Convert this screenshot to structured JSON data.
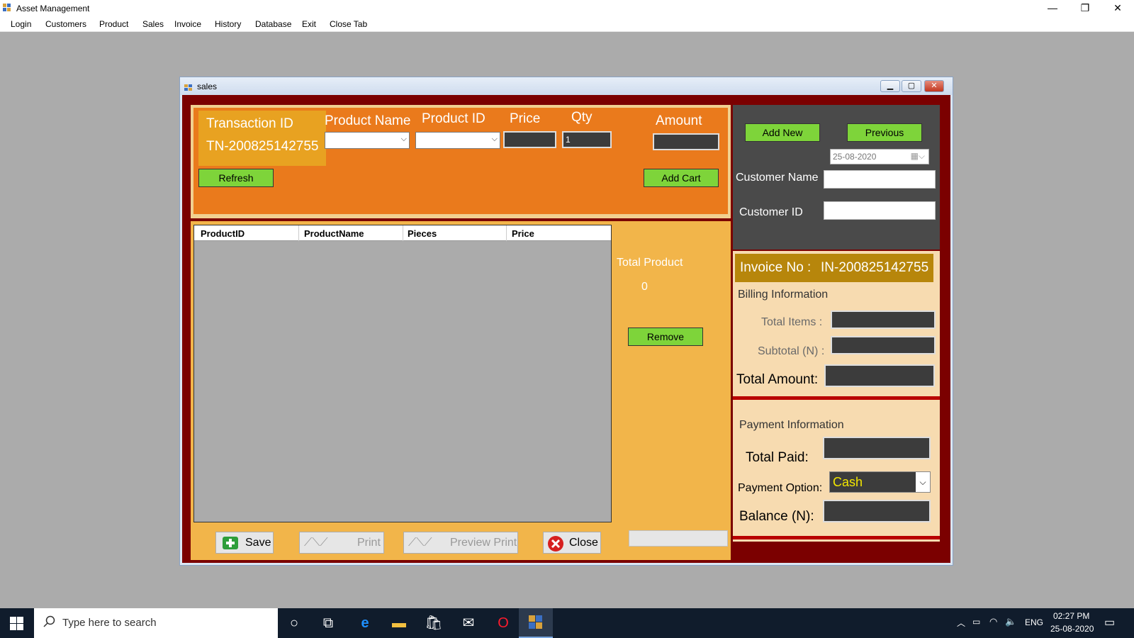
{
  "app": {
    "title": "Asset Management",
    "controls": {
      "minimize": "—",
      "maximize": "❐",
      "close": "✕"
    }
  },
  "menu": [
    "Login",
    "Customers",
    "Product",
    "Sales",
    "Invoice",
    "History",
    "Database",
    "Exit",
    "Close Tab"
  ],
  "sales_window": {
    "title": "sales",
    "transaction": {
      "label": "Transaction ID",
      "value": "TN-200825142755"
    },
    "product_name_label": "Product Name",
    "product_id_label": "Product ID",
    "price_label": "Price",
    "qty_label": "Qty",
    "qty_value": "1",
    "amount_label": "Amount",
    "refresh_label": "Refresh",
    "add_cart_label": "Add Cart",
    "grid_columns": [
      "ProductID",
      "ProductName",
      "Pieces",
      "Price"
    ],
    "total_product_label": "Total Product",
    "total_product_value": "0",
    "remove_label": "Remove",
    "save_label": "Save",
    "print_label": "Print",
    "preview_print_label": "Preview Print",
    "close_label": "Close",
    "add_new_label": "Add New",
    "previous_label": "Previous",
    "date_value": "25-08-2020",
    "customer_name_label": "Customer  Name",
    "customer_id_label": "Customer  ID",
    "invoice_label": "Invoice No :",
    "invoice_value": "IN-200825142755",
    "billing_title": "Billing Information",
    "total_items_label": "Total Items :",
    "subtotal_label": "Subtotal (N) :",
    "total_amount_label": "Total Amount:",
    "payment_title": "Payment Information",
    "total_paid_label": "Total Paid:",
    "payment_option_label": "Payment Option:",
    "payment_option_value": "Cash",
    "balance_label": "Balance (N):"
  },
  "taskbar": {
    "search_placeholder": "Type here to search",
    "language": "ENG",
    "time": "02:27 PM",
    "date": "25-08-2020"
  },
  "colors": {
    "orange": "#ea7a1c",
    "dark_red": "#7b0000",
    "green_button": "#7ed43a",
    "invoice_gold": "#b7860b"
  }
}
